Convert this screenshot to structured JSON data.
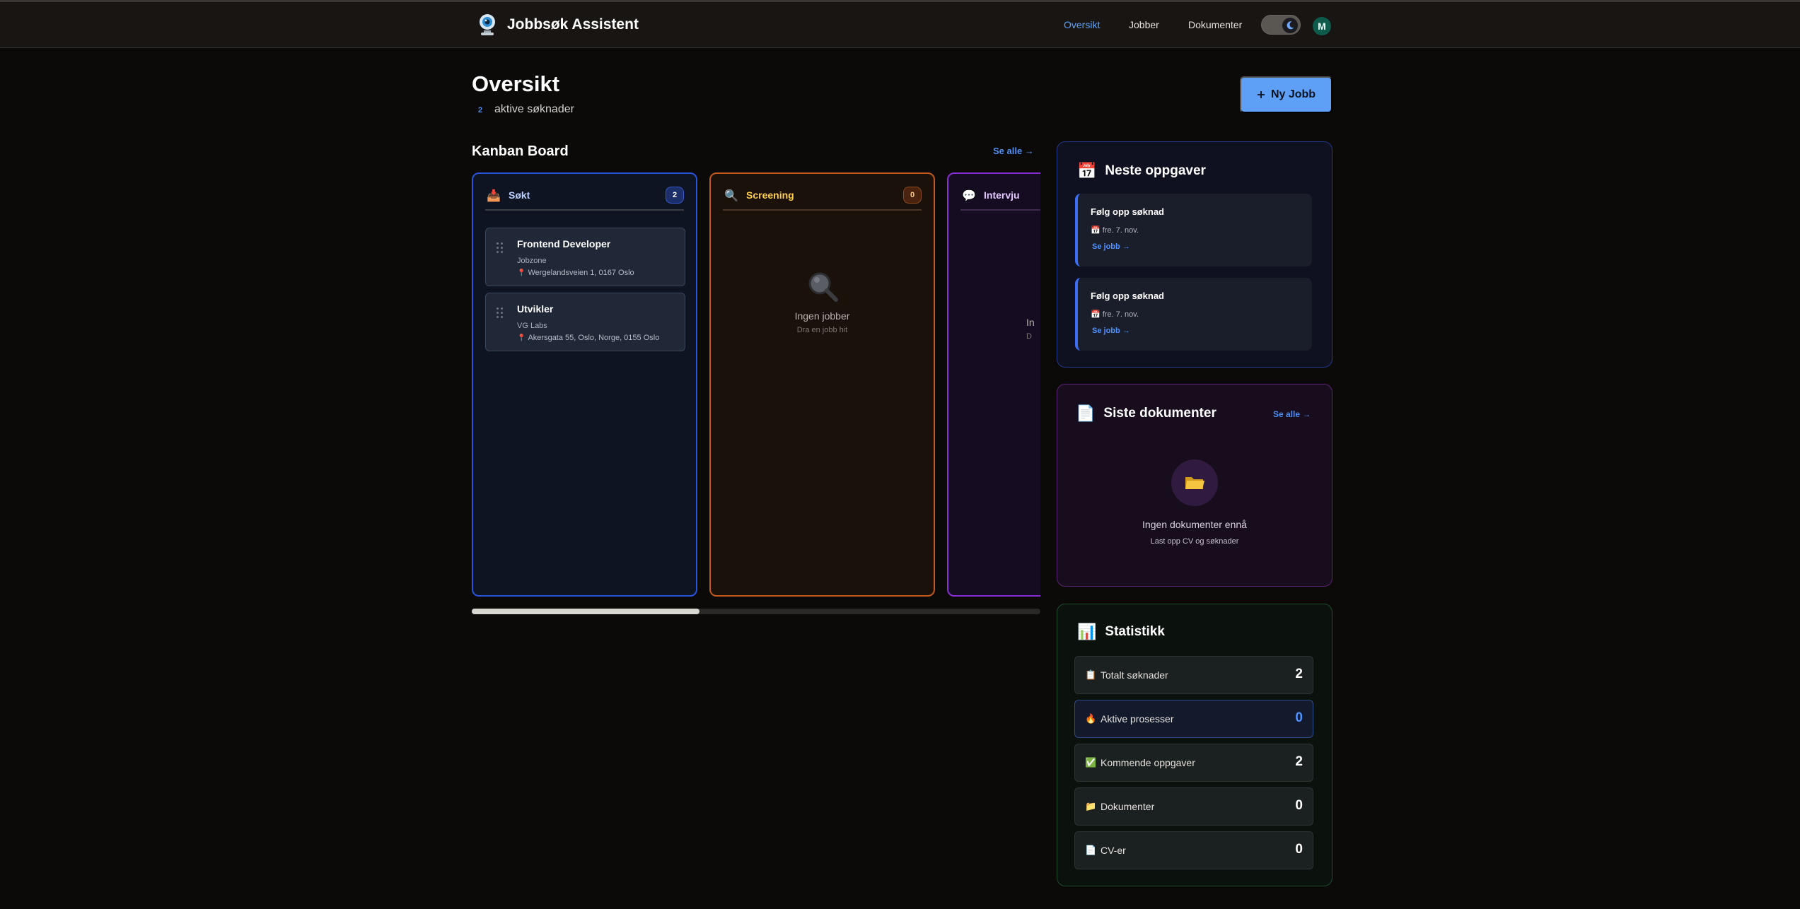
{
  "app": {
    "title": "Jobbsøk Assistent"
  },
  "nav": {
    "overview": "Oversikt",
    "jobs": "Jobber",
    "documents": "Dokumenter",
    "avatar_initial": "M"
  },
  "header": {
    "title": "Oversikt",
    "active_count": "2",
    "active_label": "aktive søknader",
    "new_job_label": "Ny Jobb"
  },
  "kanban": {
    "title": "Kanban Board",
    "see_all": "Se alle →",
    "columns": [
      {
        "name": "Søkt",
        "icon": "inbox-tray-icon",
        "count": "2",
        "jobs": [
          {
            "title": "Frontend Developer",
            "company": "Jobzone",
            "location": "Wergelandsveien 1, 0167 Oslo"
          },
          {
            "title": "Utvikler",
            "company": "VG Labs",
            "location": "Akersgata 55, Oslo, Norge, 0155 Oslo"
          }
        ]
      },
      {
        "name": "Screening",
        "icon": "magnifier-icon",
        "count": "0",
        "empty_title": "Ingen jobber",
        "empty_sub": "Dra en jobb hit"
      },
      {
        "name": "Intervju",
        "icon": "speech-bubble-icon",
        "empty_title": "In",
        "empty_sub": "D"
      }
    ],
    "scroll_position_fraction": 0.4
  },
  "tasks": {
    "title": "Neste oppgaver",
    "items": [
      {
        "title": "Følg opp søknad",
        "date": "fre. 7. nov.",
        "link": "Se jobb →"
      },
      {
        "title": "Følg opp søknad",
        "date": "fre. 7. nov.",
        "link": "Se jobb →"
      }
    ]
  },
  "docs": {
    "title": "Siste dokumenter",
    "see_all": "Se alle →",
    "empty_title": "Ingen dokumenter ennå",
    "empty_sub": "Last opp CV og søknader"
  },
  "stats": {
    "title": "Statistikk",
    "items": [
      {
        "label": "Totalt søknader",
        "value": "2",
        "icon": "clipboard-icon"
      },
      {
        "label": "Aktive prosesser",
        "value": "0",
        "icon": "fire-icon"
      },
      {
        "label": "Kommende oppgaver",
        "value": "2",
        "icon": "check-box-icon"
      },
      {
        "label": "Dokumenter",
        "value": "0",
        "icon": "folder-icon"
      },
      {
        "label": "CV-er",
        "value": "0",
        "icon": "page-icon"
      }
    ]
  },
  "colors": {
    "accent": "#5ea0f5",
    "link": "#4d8ff5",
    "applied": "#2855d8",
    "screening": "#c2581c",
    "interview": "#8a2fd1"
  }
}
